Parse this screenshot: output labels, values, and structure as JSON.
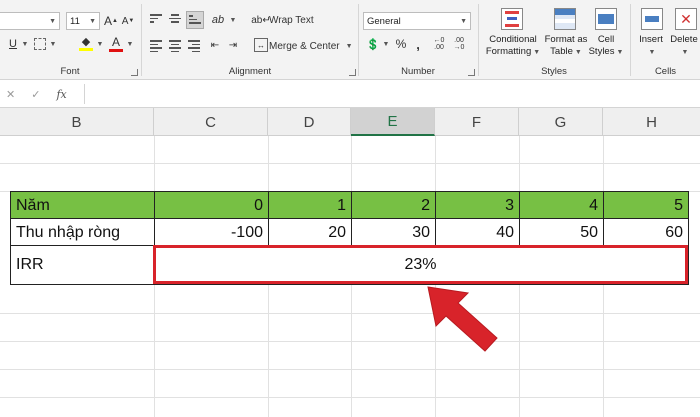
{
  "ribbon": {
    "font": {
      "size": "11",
      "label": "Font"
    },
    "alignment": {
      "wrap_text": "Wrap Text",
      "merge_center": "Merge & Center",
      "label": "Alignment"
    },
    "number": {
      "format": "General",
      "label": "Number"
    },
    "styles": {
      "conditional_formatting": [
        "Conditional",
        "Formatting"
      ],
      "format_as_table": [
        "Format as",
        "Table"
      ],
      "cell_styles": [
        "Cell",
        "Styles"
      ],
      "label": "Styles"
    },
    "cells": {
      "insert": "Insert",
      "delete": "Delete",
      "label": "Cells"
    }
  },
  "formula_bar": {
    "fx": "fx",
    "content": ""
  },
  "columns": [
    "B",
    "C",
    "D",
    "E",
    "F",
    "G",
    "H"
  ],
  "selected_column": "E",
  "table": {
    "row1": {
      "label": "Năm",
      "values": [
        "0",
        "1",
        "2",
        "3",
        "4",
        "5"
      ]
    },
    "row2": {
      "label": "Thu nhập ròng",
      "values": [
        "-100",
        "20",
        "30",
        "40",
        "50",
        "60"
      ]
    },
    "row3": {
      "label": "IRR",
      "value": "23%"
    }
  },
  "colors": {
    "header_fill": "#77c044",
    "highlight": "#d8232a",
    "accent": "#217346"
  }
}
